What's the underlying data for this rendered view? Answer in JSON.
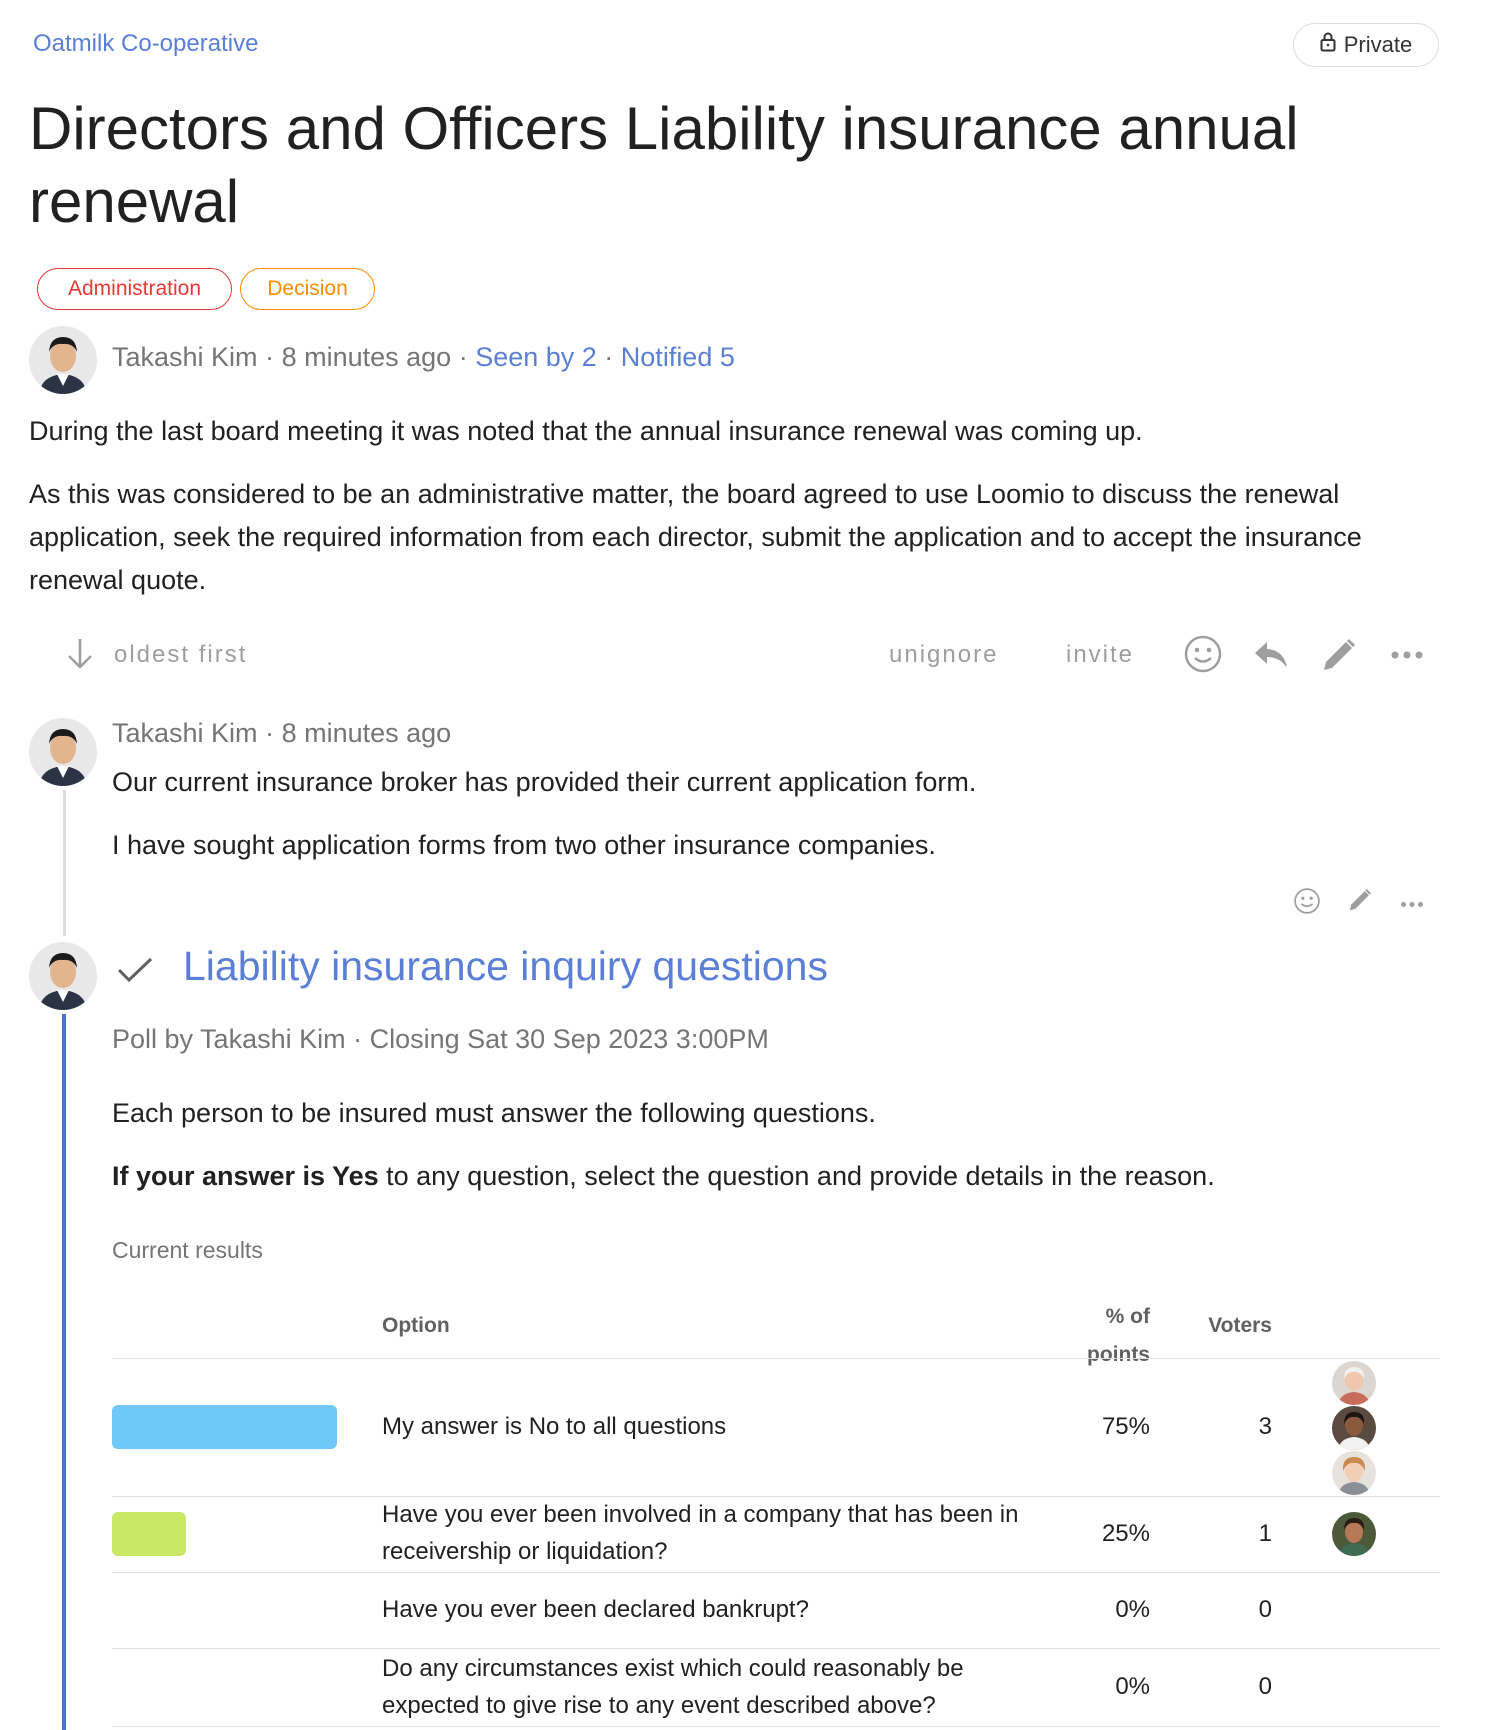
{
  "header": {
    "group_name": "Oatmilk Co-operative",
    "privacy_label": "Private",
    "title": "Directors and Officers Liability insurance annual renewal",
    "tags": [
      "Administration",
      "Decision"
    ]
  },
  "discussion": {
    "author": "Takashi Kim",
    "time": "8 minutes ago",
    "seen": "Seen by 2",
    "notified": "Notified 5",
    "paragraph_1": "During the last board meeting it was noted that the annual insurance renewal was coming up.",
    "paragraph_2": "As this was considered to be an administrative matter, the board agreed to use Loomio to discuss the renewal application, seek the required information from each director, submit the application and to accept the insurance renewal quote."
  },
  "toolbar": {
    "sort_label": "oldest first",
    "unignore_label": "unignore",
    "invite_label": "invite"
  },
  "comment": {
    "author": "Takashi Kim",
    "time": "8 minutes ago",
    "paragraph_1": "Our current insurance broker has provided their current application form.",
    "paragraph_2": "I have sought application forms from two other insurance companies."
  },
  "poll": {
    "title": "Liability insurance inquiry questions",
    "meta": "Poll by Takashi Kim · Closing Sat 30 Sep 2023 3:00PM",
    "description_1": "Each person to be insured must answer the following questions.",
    "description_2_bold": "If your answer is Yes",
    "description_2_rest": " to any question, select the question and provide details in the reason.",
    "results_label": "Current results",
    "columns": {
      "option": "Option",
      "percent_line1": "% of",
      "percent_line2": "points",
      "voters": "Voters"
    },
    "rows": [
      {
        "bar_fraction": 0.75,
        "bar_color": "#6fc8f7",
        "option": "My answer is No to all questions",
        "percent": "75%",
        "voters": "3"
      },
      {
        "bar_fraction": 0.25,
        "bar_color": "#c9e865",
        "option": "Have you ever been involved in a company that has been in receivership or liquidation?",
        "percent": "25%",
        "voters": "1"
      },
      {
        "bar_fraction": 0,
        "bar_color": "",
        "option": "Have you ever been declared bankrupt?",
        "percent": "0%",
        "voters": "0"
      },
      {
        "bar_fraction": 0,
        "bar_color": "",
        "option": "Do any circumstances exist which could reasonably be expected to give rise to any event described above?",
        "percent": "0%",
        "voters": "0"
      }
    ]
  },
  "colors": {
    "link": "#5b7fd6",
    "tag_administration": "#e53935",
    "tag_decision": "#fb8c00",
    "poll_thread_line": "#4a6fd0"
  },
  "icons": [
    "lock-icon",
    "arrow-down-icon",
    "smiley-icon",
    "reply-icon",
    "pencil-icon",
    "more-horiz-icon",
    "checkmark-icon"
  ]
}
